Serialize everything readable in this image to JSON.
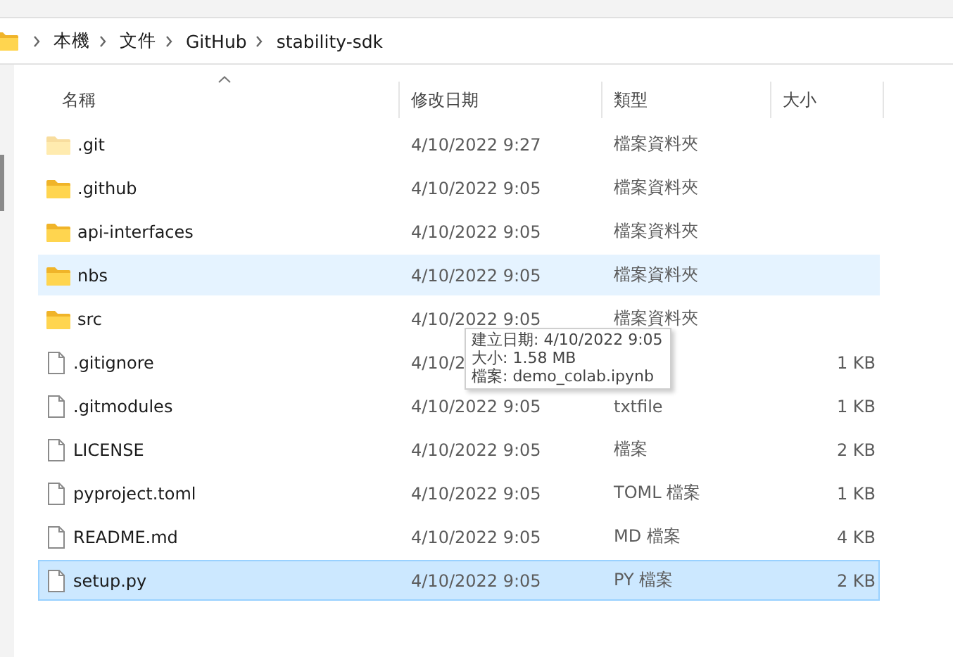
{
  "breadcrumb": [
    "本機",
    "文件",
    "GitHub",
    "stability-sdk"
  ],
  "columns": [
    {
      "label": "名稱",
      "sorted": true
    },
    {
      "label": "修改日期",
      "sorted": false
    },
    {
      "label": "類型",
      "sorted": false
    },
    {
      "label": "大小",
      "sorted": false
    }
  ],
  "rows": [
    {
      "kind": "folder",
      "name": ".git",
      "hidden": true,
      "modified": "4/10/2022 9:27",
      "type": "檔案資料夾",
      "hovered": false,
      "selected": false
    },
    {
      "kind": "folder",
      "name": ".github",
      "hidden": false,
      "modified": "4/10/2022 9:05",
      "type": "檔案資料夾",
      "hovered": false,
      "selected": false
    },
    {
      "kind": "folder",
      "name": "api-interfaces",
      "hidden": false,
      "modified": "4/10/2022 9:05",
      "type": "檔案資料夾",
      "hovered": false,
      "selected": false
    },
    {
      "kind": "folder",
      "name": "nbs",
      "hidden": false,
      "modified": "4/10/2022 9:05",
      "type": "檔案資料夾",
      "hovered": true,
      "selected": false
    },
    {
      "kind": "folder",
      "name": "src",
      "hidden": false,
      "modified": "4/10/2022 9:05",
      "type": "檔案資料夾",
      "hovered": false,
      "selected": false
    },
    {
      "kind": "file",
      "name": ".gitignore",
      "hidden": false,
      "modified": "4/10/2",
      "size": "1 KB",
      "hovered": false,
      "selected": false
    },
    {
      "kind": "file",
      "name": ".gitmodules",
      "hidden": false,
      "modified": "4/10/2022 9:05",
      "type": "txtfile",
      "size": "1 KB",
      "hovered": false,
      "selected": false
    },
    {
      "kind": "file",
      "name": "LICENSE",
      "hidden": false,
      "modified": "4/10/2022 9:05",
      "type": "檔案",
      "size": "2 KB",
      "hovered": false,
      "selected": false
    },
    {
      "kind": "file",
      "name": "pyproject.toml",
      "hidden": false,
      "modified": "4/10/2022 9:05",
      "type": "TOML 檔案",
      "size": "1 KB",
      "hovered": false,
      "selected": false
    },
    {
      "kind": "file",
      "name": "README.md",
      "hidden": false,
      "modified": "4/10/2022 9:05",
      "type": "MD 檔案",
      "size": "4 KB",
      "hovered": false,
      "selected": false
    },
    {
      "kind": "file",
      "name": "setup.py",
      "hidden": false,
      "modified": "4/10/2022 9:05",
      "type": "PY 檔案",
      "size": "2 KB",
      "hovered": false,
      "selected": true
    }
  ],
  "tooltip": {
    "lines": [
      "建立日期: 4/10/2022 9:05",
      "大小: 1.58 MB",
      "檔案: demo_colab.ipynb"
    ]
  }
}
